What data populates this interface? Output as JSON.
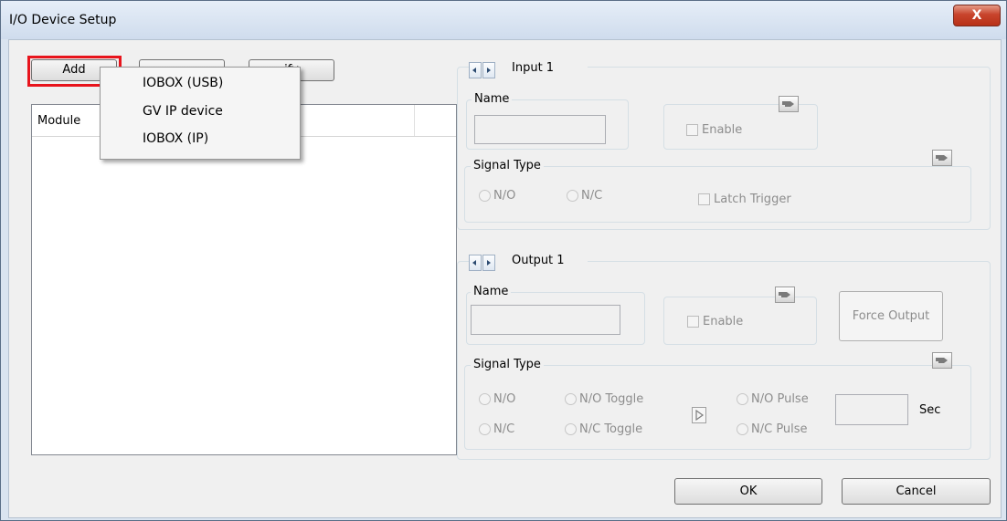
{
  "window": {
    "title": "I/O Device Setup",
    "close_label": "X"
  },
  "toolbar": {
    "add_label": "Add",
    "remove_label": "",
    "modify_label": "Modify",
    "modify_visible_label": "ify"
  },
  "add_menu": {
    "items": [
      "IOBOX (USB)",
      "GV IP device",
      "IOBOX (IP)"
    ]
  },
  "module_list": {
    "column_header": "Module"
  },
  "input_section": {
    "title": "Input 1",
    "name_label": "Name",
    "name_value": "",
    "enable_label": "Enable",
    "signal_type_label": "Signal Type",
    "no_label": "N/O",
    "nc_label": "N/C",
    "latch_label": "Latch Trigger"
  },
  "output_section": {
    "title": "Output 1",
    "name_label": "Name",
    "name_value": "",
    "enable_label": "Enable",
    "force_output_label": "Force Output",
    "signal_type_label": "Signal Type",
    "no_label": "N/O",
    "nc_label": "N/C",
    "no_toggle_label": "N/O Toggle",
    "nc_toggle_label": "N/C Toggle",
    "no_pulse_label": "N/O Pulse",
    "nc_pulse_label": "N/C Pulse",
    "pulse_value": "",
    "sec_label": "Sec"
  },
  "footer": {
    "ok_label": "OK",
    "cancel_label": "Cancel"
  },
  "colors": {
    "highlight": "#e8141c",
    "title_bg": "#dae4f0",
    "close_bg": "#c8442c",
    "disabled_text": "#8d8d8d"
  },
  "icons": [
    "hand-pointer-icon",
    "arrow-left-icon",
    "arrow-right-icon",
    "play-icon"
  ]
}
